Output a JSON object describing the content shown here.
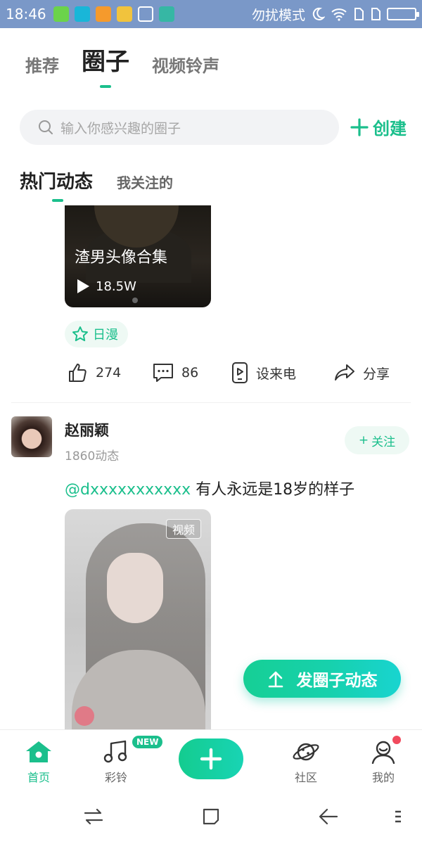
{
  "status_bar": {
    "time": "18:46",
    "mode": "勿扰模式"
  },
  "top_tabs": [
    {
      "label": "推荐",
      "active": false
    },
    {
      "label": "圈子",
      "active": true
    },
    {
      "label": "视频铃声",
      "active": false
    }
  ],
  "search": {
    "placeholder": "输入你感兴趣的圈子",
    "create_label": "创建"
  },
  "feed_tabs": [
    {
      "label": "热门动态",
      "active": true
    },
    {
      "label": "我关注的",
      "active": false
    }
  ],
  "post1": {
    "video_title": "渣男头像合集",
    "views": "18.5W",
    "tag": "日漫",
    "actions": {
      "likes": "274",
      "comments": "86",
      "set_ringtone": "设来电",
      "share": "分享"
    }
  },
  "post2": {
    "author": "赵丽颖",
    "author_meta": "1860动态",
    "follow_label": "关注",
    "mention": "@dxxxxxxxxxxx",
    "text": "有人永远是18岁的样子",
    "video_badge": "视频"
  },
  "fab": {
    "label": "发圈子动态"
  },
  "bottom_nav": {
    "items": [
      {
        "label": "首页",
        "icon": "home-icon",
        "active": true
      },
      {
        "label": "彩铃",
        "icon": "music-note-icon",
        "active": false
      },
      {
        "label": "社区",
        "icon": "planet-icon",
        "active": false
      },
      {
        "label": "我的",
        "icon": "profile-icon",
        "active": false
      }
    ],
    "new_badge": "NEW"
  },
  "colors": {
    "accent": "#1bbf8c",
    "status_bar": "#7a98c8"
  }
}
